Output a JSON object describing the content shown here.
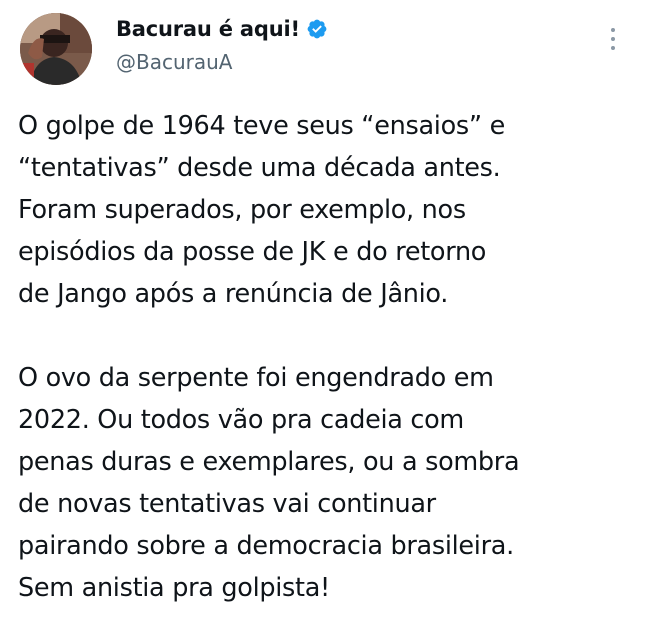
{
  "author": {
    "display_name": "Bacurau é aqui!",
    "handle": "@BacurauA",
    "verified": true,
    "verified_color": "#1d9bf0"
  },
  "icons": {
    "verified": "verified-badge-icon",
    "more": "more-vertical-icon",
    "avatar": "profile-photo"
  },
  "tweet": {
    "paragraphs": [
      {
        "lines": [
          "O golpe de 1964 teve seus “ensaios” e",
          "“tentativas” desde uma década antes.",
          "Foram superados, por exemplo, nos",
          "episódios da posse de JK e do retorno",
          "de Jango após a renúncia de Jânio."
        ]
      },
      {
        "lines": [
          "O ovo da serpente foi engendrado em",
          "2022. Ou todos vão pra cadeia com",
          "penas duras e exemplares, ou a sombra",
          "de novas tentativas vai continuar",
          "pairando sobre a democracia brasileira.",
          "Sem anistia pra golpista!"
        ]
      }
    ]
  }
}
